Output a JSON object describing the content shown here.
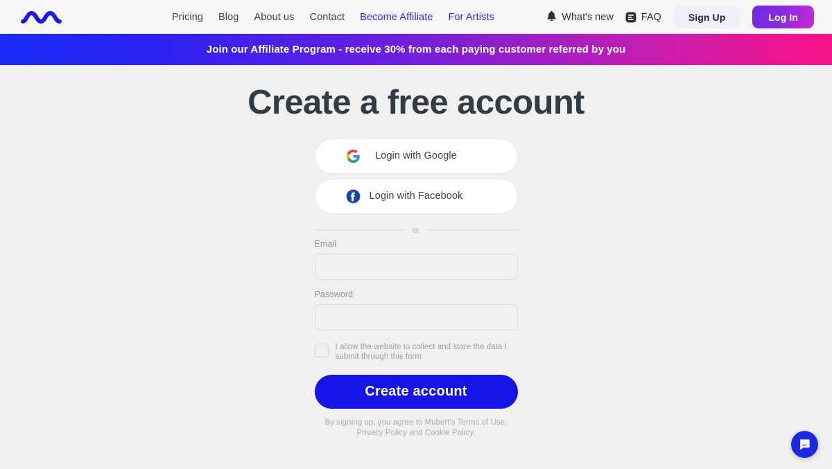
{
  "header": {
    "logo_name": "mubert-wave-logo",
    "nav": [
      {
        "label": "Pricing",
        "accent": false
      },
      {
        "label": "Blog",
        "accent": false
      },
      {
        "label": "About us",
        "accent": false
      },
      {
        "label": "Contact",
        "accent": false
      },
      {
        "label": "Become Affiliate",
        "accent": true
      },
      {
        "label": "For Artists",
        "accent": true
      }
    ],
    "whats_new": {
      "label": "What's new",
      "icon": "bell-icon"
    },
    "faq": {
      "label": "FAQ",
      "icon": "faq-icon"
    },
    "sign_up_label": "Sign Up",
    "log_in_label": "Log In"
  },
  "banner": {
    "text": "Join our Affiliate Program - receive 30% from each paying customer referred by you",
    "gradient_start": "#1a2bf5",
    "gradient_end": "#fa1387"
  },
  "main": {
    "title": "Create a free account",
    "social": [
      {
        "label": "Login with Google",
        "icon": "google-icon"
      },
      {
        "label": "Login with Facebook",
        "icon": "facebook-icon"
      }
    ],
    "divider_text": "or",
    "fields": [
      {
        "label": "Email",
        "value": "",
        "placeholder": ""
      },
      {
        "label": "Password",
        "value": "",
        "placeholder": ""
      }
    ],
    "consent_text": "I allow the website to collect and store the data I submit through this form",
    "consent_checked": false,
    "submit_label": "Create account",
    "legal_text": "By signing up, you agree to Mubert's Terms of Use, Privacy Policy and Cookie Policy."
  },
  "chat": {
    "icon": "chat-bubble-icon",
    "color": "#1b2ae0"
  },
  "colors": {
    "page_background": "#f0f0f0",
    "header_background": "#f7f7f8",
    "primary_blue": "#1515e8",
    "nav_accent": "#2c2ce8",
    "title": "#333b44"
  }
}
